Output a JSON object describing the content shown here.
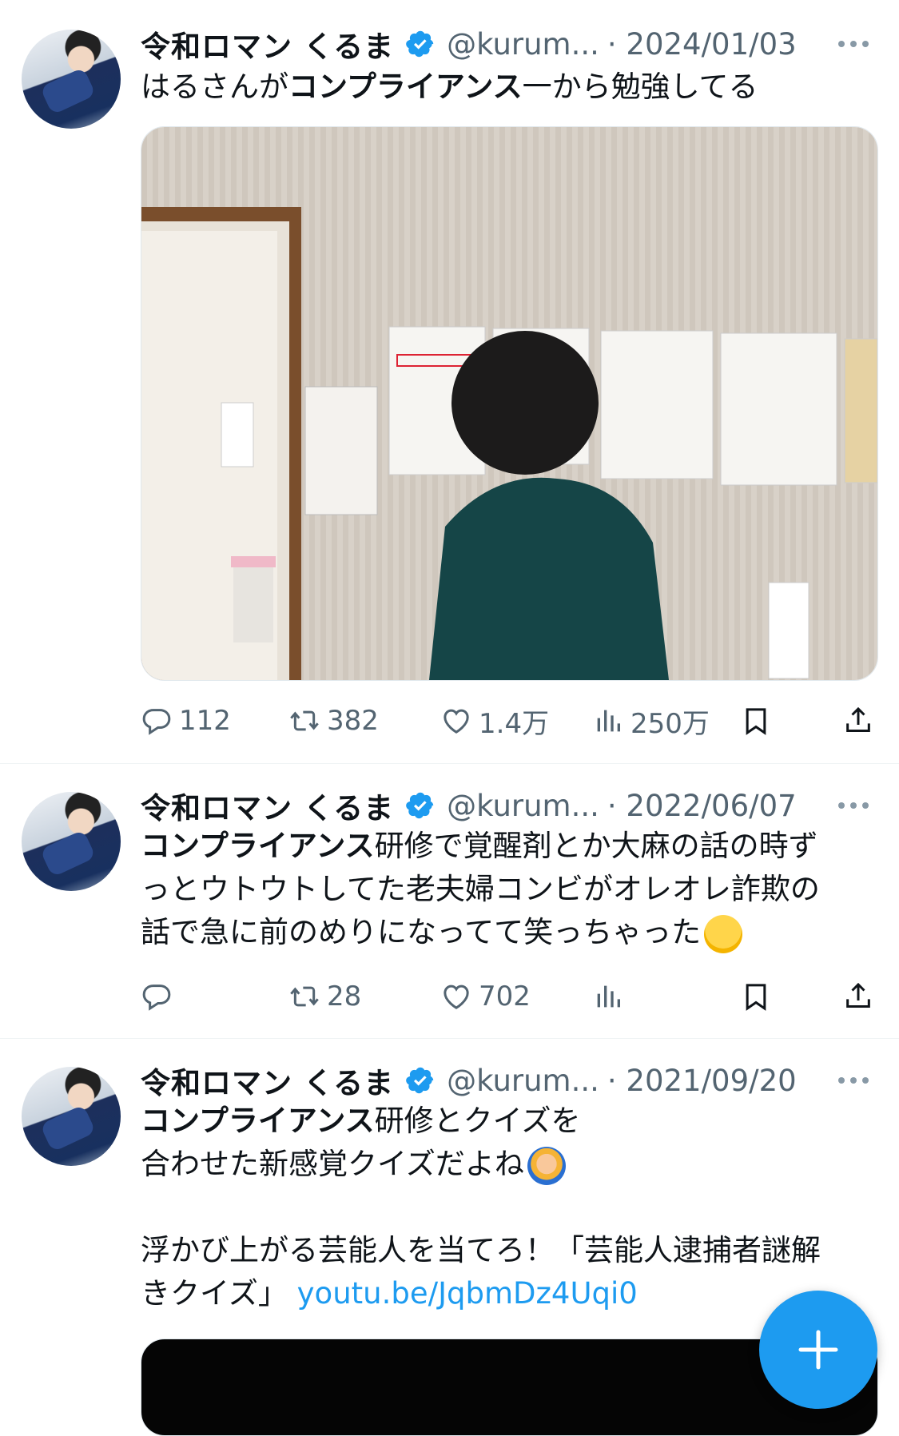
{
  "tweets": [
    {
      "name": "令和ロマン くるま",
      "handle": "@kurum...",
      "date": "· 2024/01/03",
      "text_plain_1": "はるさんが",
      "text_bold_1": "コンプライアンス",
      "text_plain_2": "一から勉強してる",
      "image_label": "photo",
      "reply_count": "112",
      "retweet_count": "382",
      "like_count": "1.4万",
      "view_count": "250万"
    },
    {
      "name": "令和ロマン くるま",
      "handle": "@kurum...",
      "date": "· 2022/06/07",
      "line1_bold": "コンプライアンス",
      "line1_plain": "研修で覚醒剤とか大麻の話の時ず",
      "line2": "っとウトウトしてた老夫婦コンビがオレオレ詐欺の",
      "line3": "話で急に前のめりになってて笑っちゃった",
      "reply_count": "",
      "retweet_count": "28",
      "like_count": "702",
      "view_count": ""
    },
    {
      "name": "令和ロマン くるま",
      "handle": "@kurum...",
      "date": "· 2021/09/20",
      "line1_bold": "コンプライアンス",
      "line1_plain": "研修とクイズを",
      "line2": "合わせた新感覚クイズだよね",
      "line3": "浮かび上がる芸能人を当てろ！「芸能人逮捕者謎解",
      "line4": "きクイズ」",
      "link": "youtu.be/JqbmDz4Uqi0"
    }
  ],
  "icons": {
    "verified": "verified-badge-icon",
    "more": "more-icon",
    "reply": "reply-icon",
    "retweet": "retweet-icon",
    "like": "heart-icon",
    "views": "views-icon",
    "bookmark": "bookmark-icon",
    "share": "share-icon",
    "compose": "plus-icon"
  },
  "colors": {
    "accent": "#1d9bf0",
    "secondary_text": "#536471"
  }
}
